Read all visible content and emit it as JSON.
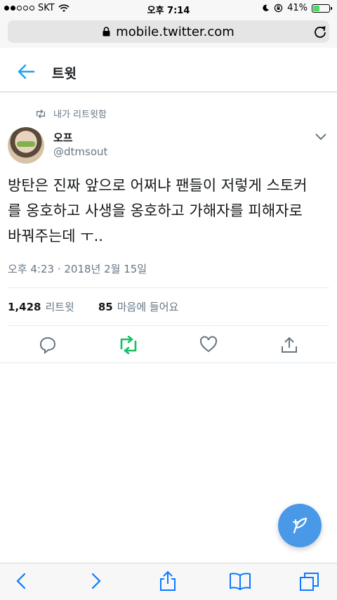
{
  "status_bar": {
    "carrier": "SKT",
    "time": "오후 7:14",
    "battery_percent": "41%",
    "battery_level": 0.41,
    "signal_bars_filled": 2,
    "signal_bars_total": 5
  },
  "browser": {
    "url": "mobile.twitter.com"
  },
  "header": {
    "title": "트윗"
  },
  "tweet": {
    "retweet_context": "내가 리트윗함",
    "display_name": "오프",
    "handle": "@dtmsout",
    "text_lines": [
      "방탄은 진짜 앞으로 어쩌냐 팬들이 저렇게 스토커",
      "를 옹호하고 사생을 옹호하고 가해자를 피해자로",
      "바꿔주는데 ㅜ.."
    ],
    "timestamp": "오후 4:23 · 2018년 2월 15일",
    "retweets_count": "1,428",
    "retweets_label": "리트윗",
    "likes_count": "85",
    "likes_label": "마음에 들어요"
  },
  "colors": {
    "accent": "#1da1f2",
    "retweeted": "#17bf63",
    "muted": "#657786",
    "compose_button": "#4a99e9",
    "safari_blue": "#0a7aff"
  },
  "icons": {
    "back": "arrow-left-icon",
    "retweet_context": "retweet-icon",
    "caret": "chevron-down-icon",
    "reply": "reply-icon",
    "retweet": "retweet-icon",
    "like": "heart-icon",
    "share": "share-icon",
    "compose": "compose-feather-icon"
  }
}
